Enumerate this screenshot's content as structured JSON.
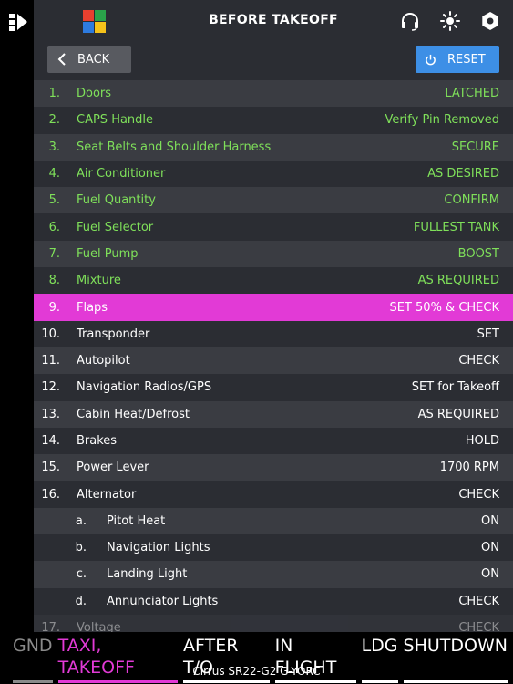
{
  "header": {
    "title": "BEFORE TAKEOFF"
  },
  "buttons": {
    "back_label": "BACK",
    "reset_label": "RESET"
  },
  "colors": {
    "done": "#7fe05a",
    "active": "#e23ad6",
    "reset": "#3d8fe6"
  },
  "checklist": [
    {
      "num": "1.",
      "label": "Doors",
      "value": "LATCHED",
      "state": "done"
    },
    {
      "num": "2.",
      "label": "CAPS Handle",
      "value": "Verify Pin Removed",
      "state": "done"
    },
    {
      "num": "3.",
      "label": "Seat Belts and Shoulder Harness",
      "value": "SECURE",
      "state": "done"
    },
    {
      "num": "4.",
      "label": "Air Conditioner",
      "value": "AS DESIRED",
      "state": "done"
    },
    {
      "num": "5.",
      "label": "Fuel Quantity",
      "value": "CONFIRM",
      "state": "done"
    },
    {
      "num": "6.",
      "label": "Fuel Selector",
      "value": "FULLEST TANK",
      "state": "done"
    },
    {
      "num": "7.",
      "label": "Fuel Pump",
      "value": "BOOST",
      "state": "done"
    },
    {
      "num": "8.",
      "label": "Mixture",
      "value": "AS REQUIRED",
      "state": "done"
    },
    {
      "num": "9.",
      "label": "Flaps",
      "value": "SET 50% & CHECK",
      "state": "active"
    },
    {
      "num": "10.",
      "label": "Transponder",
      "value": "SET",
      "state": "pending"
    },
    {
      "num": "11.",
      "label": "Autopilot",
      "value": "CHECK",
      "state": "pending"
    },
    {
      "num": "12.",
      "label": "Navigation Radios/GPS",
      "value": "SET for Takeoff",
      "state": "pending"
    },
    {
      "num": "13.",
      "label": "Cabin Heat/Defrost",
      "value": "AS REQUIRED",
      "state": "pending"
    },
    {
      "num": "14.",
      "label": "Brakes",
      "value": "HOLD",
      "state": "pending"
    },
    {
      "num": "15.",
      "label": "Power Lever",
      "value": "1700 RPM",
      "state": "pending"
    },
    {
      "num": "16.",
      "label": "Alternator",
      "value": "CHECK",
      "state": "pending"
    },
    {
      "num": "a.",
      "label": "Pitot Heat",
      "value": "ON",
      "state": "pending",
      "sub": true
    },
    {
      "num": "b.",
      "label": "Navigation Lights",
      "value": "ON",
      "state": "pending",
      "sub": true
    },
    {
      "num": "c.",
      "label": "Landing Light",
      "value": "ON",
      "state": "pending",
      "sub": true
    },
    {
      "num": "d.",
      "label": "Annunciator Lights",
      "value": "CHECK",
      "state": "pending",
      "sub": true
    },
    {
      "num": "17.",
      "label": "Voltage",
      "value": "CHECK",
      "state": "pending",
      "faded": true
    }
  ],
  "phases": [
    {
      "label": "GND",
      "state": "prev"
    },
    {
      "label": "TAXI, TAKEOFF",
      "state": "cur"
    },
    {
      "label": "AFTER T/O",
      "state": "next"
    },
    {
      "label": "IN FLIGHT",
      "state": "next"
    },
    {
      "label": "LDG",
      "state": "next"
    },
    {
      "label": "SHUTDOWN",
      "state": "next"
    }
  ],
  "footer": {
    "aircraft": "Cirrus SR22-G2 G-YORC"
  },
  "icons": {
    "sidebar": "sidebar-toggle-icon",
    "logo": "app-logo-icon",
    "audio": "headset-icon",
    "brightness": "brightness-icon",
    "settings": "gear-icon",
    "back": "chevron-left-icon",
    "reset": "power-icon"
  }
}
